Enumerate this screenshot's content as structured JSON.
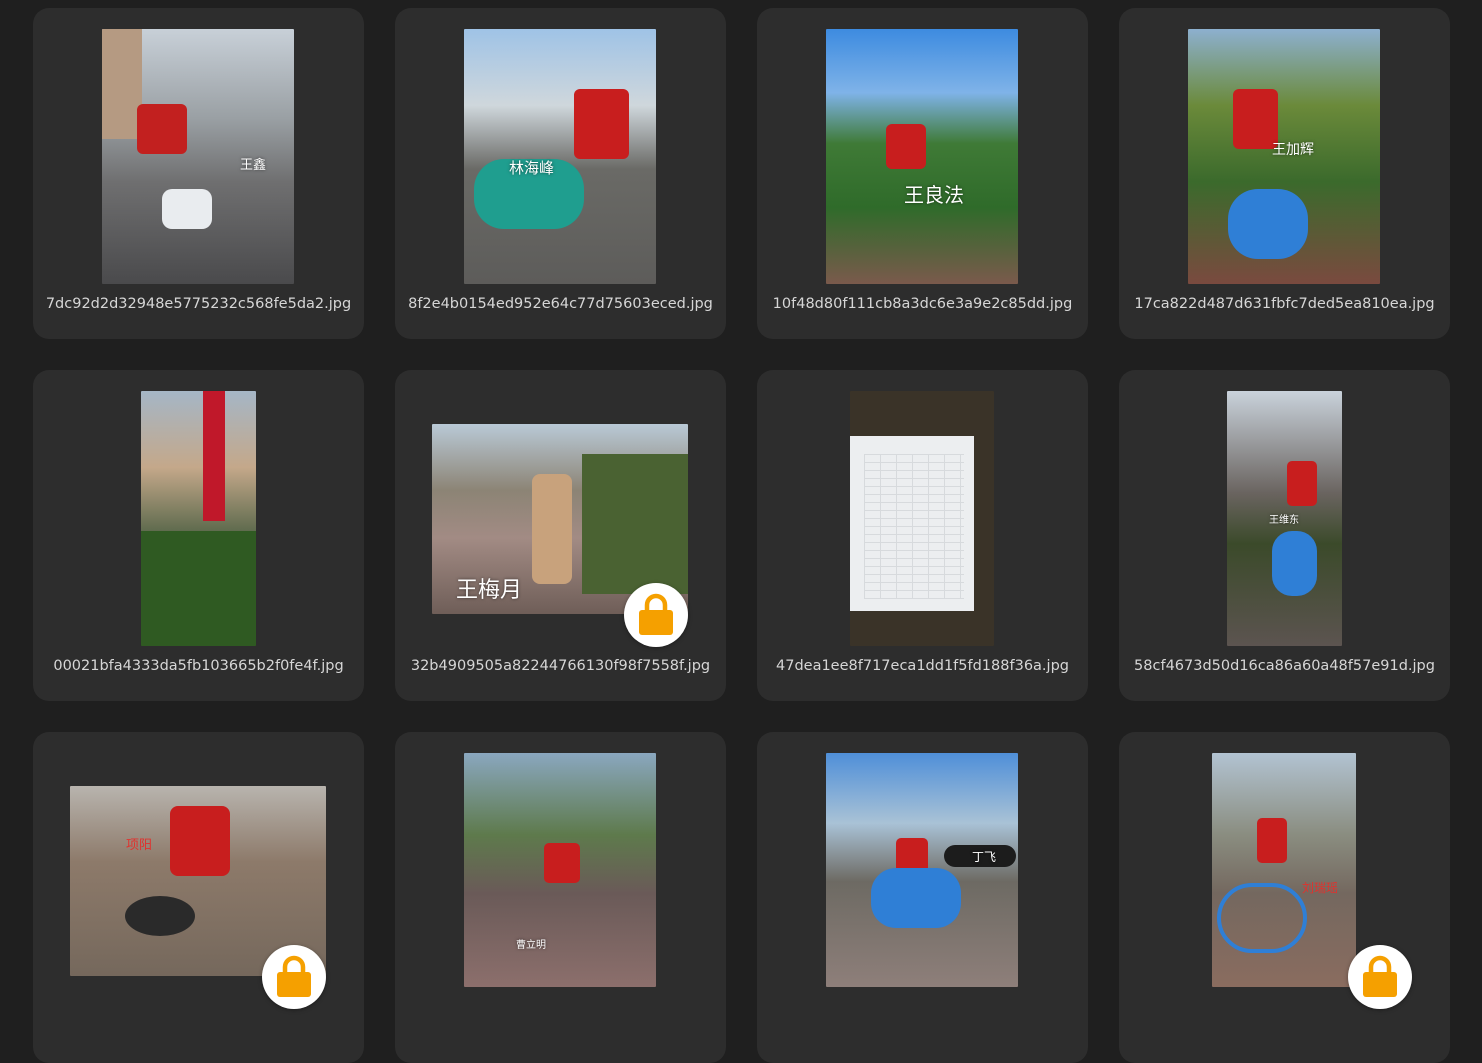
{
  "items": [
    {
      "filename": "7dc92d2d32948e5775232c568fe5da2.jpg",
      "overlay": "王鑫",
      "locked": false
    },
    {
      "filename": "8f2e4b0154ed952e64c77d75603eced.jpg",
      "overlay": "林海峰",
      "locked": false
    },
    {
      "filename": "10f48d80f111cb8a3dc6e3a9e2c85dd.jpg",
      "overlay": "王良法",
      "locked": false
    },
    {
      "filename": "17ca822d487d631fbfc7ded5ea810ea.jpg",
      "overlay": "王加辉",
      "locked": false
    },
    {
      "filename": "00021bfa4333da5fb103665b2f0fe4f.jpg",
      "overlay": "",
      "locked": false
    },
    {
      "filename": "32b4909505a82244766130f98f7558f.jpg",
      "overlay": "王梅月",
      "locked": true
    },
    {
      "filename": "47dea1ee8f717eca1dd1f5fd188f36a.jpg",
      "overlay": "",
      "locked": false
    },
    {
      "filename": "58cf4673d50d16ca86a60a48f57e91d.jpg",
      "overlay": "王维东",
      "locked": false
    },
    {
      "filename": "",
      "overlay": "项阳",
      "locked": true
    },
    {
      "filename": "",
      "overlay": "曹立明",
      "locked": false
    },
    {
      "filename": "",
      "overlay": "丁飞",
      "locked": false
    },
    {
      "filename": "",
      "overlay": "刘瑞瑶",
      "locked": true
    }
  ],
  "colors": {
    "background": "#1f1f1f",
    "card": "#2d2d2d",
    "lock_accent": "#f5a000"
  },
  "icons": {
    "lock": "lock-icon"
  }
}
